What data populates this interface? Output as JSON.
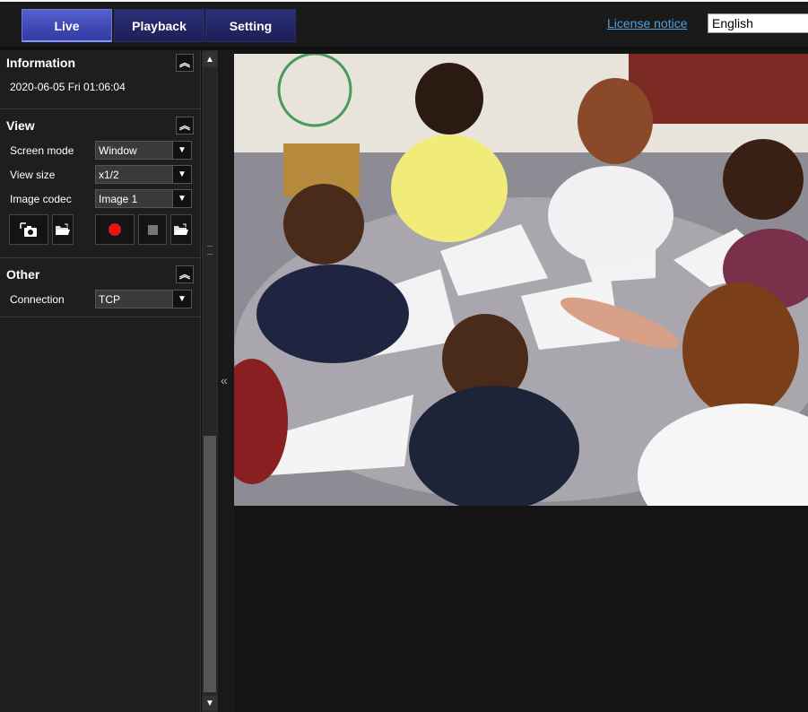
{
  "tabs": [
    {
      "label": "Live",
      "active": true
    },
    {
      "label": "Playback",
      "active": false
    },
    {
      "label": "Setting",
      "active": false
    }
  ],
  "header": {
    "license_link": "License notice",
    "language": "English"
  },
  "information": {
    "title": "Information",
    "datetime": "2020-06-05 Fri 01:06:04"
  },
  "view": {
    "title": "View",
    "screen_mode": {
      "label": "Screen mode",
      "value": "Window"
    },
    "view_size": {
      "label": "View size",
      "value": "x1/2"
    },
    "image_codec": {
      "label": "Image codec",
      "value": "Image 1"
    }
  },
  "other": {
    "title": "Other",
    "connection": {
      "label": "Connection",
      "value": "TCP"
    }
  },
  "icons": {
    "collapse": "double-chevron-up-icon",
    "capture": "camera-capture-icon",
    "folder": "folder-open-icon",
    "record": "record-icon",
    "stop": "stop-icon",
    "panel_toggle": "double-chevron-left-icon"
  },
  "colors": {
    "active_tab": "#4a52c0",
    "tab": "#252a6a",
    "link": "#4aa3e0",
    "record": "#ee1111"
  }
}
